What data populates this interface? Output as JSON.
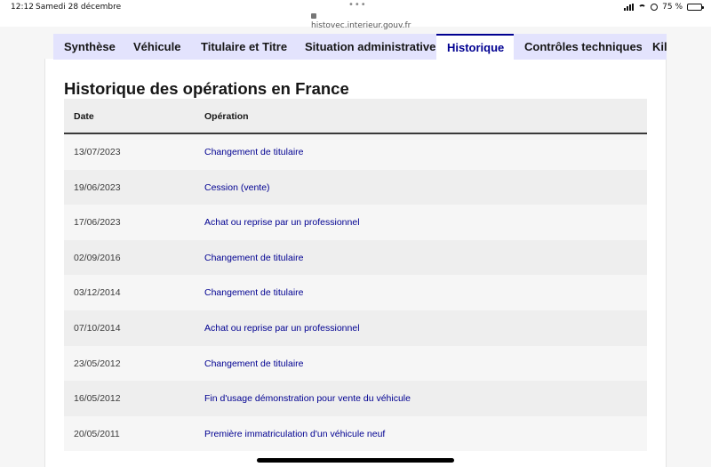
{
  "status_bar": {
    "time": "12:12",
    "date": "Samedi 28 décembre",
    "dots": "•••",
    "url": "histovec.interieur.gouv.fr",
    "battery_text": "75 %",
    "battery_level": 0.75
  },
  "tabs": [
    {
      "label": "Synthèse",
      "active": false
    },
    {
      "label": "Véhicule",
      "active": false
    },
    {
      "label": "Titulaire et Titre",
      "active": false
    },
    {
      "label": "Situation administrative",
      "active": false
    },
    {
      "label": "Historique",
      "active": true
    },
    {
      "label": "Contrôles techniques",
      "active": false
    },
    {
      "label": "Kil",
      "active": false
    }
  ],
  "section": {
    "title": "Historique des opérations en France"
  },
  "table": {
    "headers": {
      "date": "Date",
      "operation": "Opération"
    },
    "rows": [
      {
        "date": "13/07/2023",
        "operation": "Changement de titulaire"
      },
      {
        "date": "19/06/2023",
        "operation": "Cession (vente)"
      },
      {
        "date": "17/06/2023",
        "operation": "Achat ou reprise par un professionnel"
      },
      {
        "date": "02/09/2016",
        "operation": "Changement de titulaire"
      },
      {
        "date": "03/12/2014",
        "operation": "Changement de titulaire"
      },
      {
        "date": "07/10/2014",
        "operation": "Achat ou reprise par un professionnel"
      },
      {
        "date": "23/05/2012",
        "operation": "Changement de titulaire"
      },
      {
        "date": "16/05/2012",
        "operation": "Fin d'usage démonstration pour vente du véhicule"
      },
      {
        "date": "20/05/2011",
        "operation": "Première immatriculation d'un véhicule neuf"
      }
    ]
  },
  "colors": {
    "accent": "#000091",
    "tab_bg": "#e3e3fd",
    "row_odd": "#f6f6f6",
    "row_even": "#eeeeee"
  }
}
